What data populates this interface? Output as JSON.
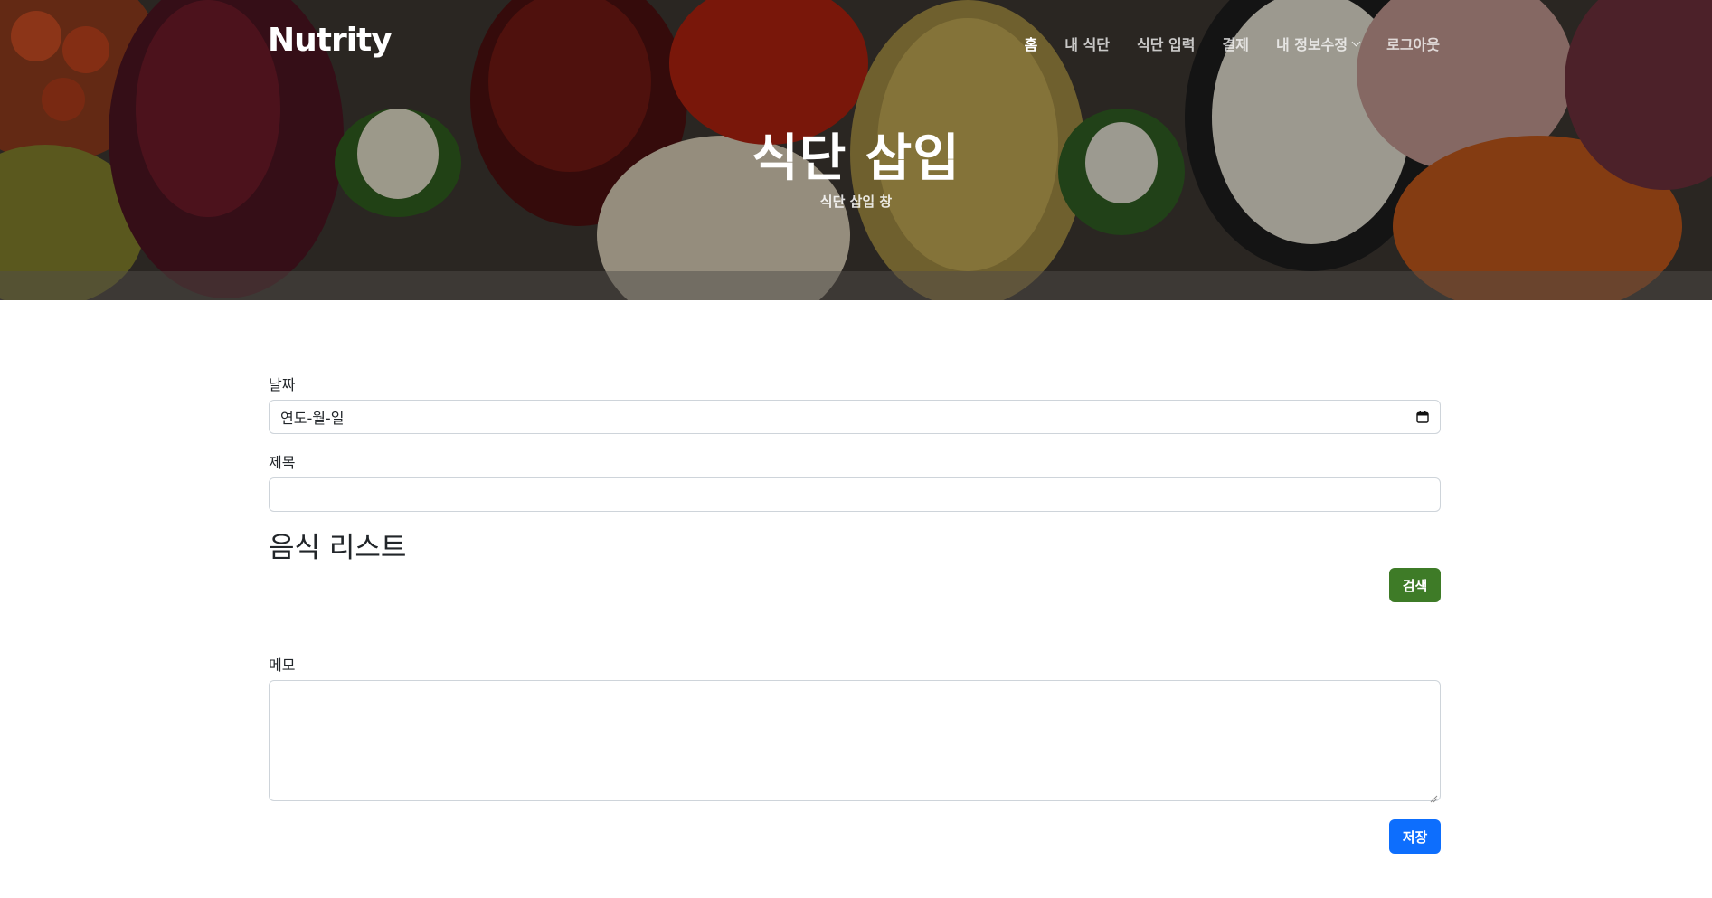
{
  "brand": {
    "logo": "Nutrity"
  },
  "nav": {
    "items": [
      {
        "label": "홈",
        "active": true
      },
      {
        "label": "내 식단",
        "active": false
      },
      {
        "label": "식단 입력",
        "active": false
      },
      {
        "label": "결제",
        "active": false
      },
      {
        "label": "내 정보수정",
        "active": false,
        "dropdown": true
      },
      {
        "label": "로그아웃",
        "active": false
      }
    ]
  },
  "hero": {
    "title": "식단 삽입",
    "subtitle": "식단 삽입 창"
  },
  "form": {
    "date_label": "날짜",
    "date_value": "연도-월-일",
    "title_label": "제목",
    "title_value": "",
    "food_list_heading": "음식 리스트",
    "search_button": "검색",
    "memo_label": "메모",
    "memo_value": "",
    "save_button": "저장"
  },
  "colors": {
    "search_button": "#3e7b27",
    "save_button": "#0d6efd",
    "text": "#212529",
    "border": "#ced4da"
  },
  "icons": {
    "date_picker": "calendar-icon",
    "dropdown": "chevron-down-icon",
    "textarea_resize": "resize-handle-icon"
  }
}
